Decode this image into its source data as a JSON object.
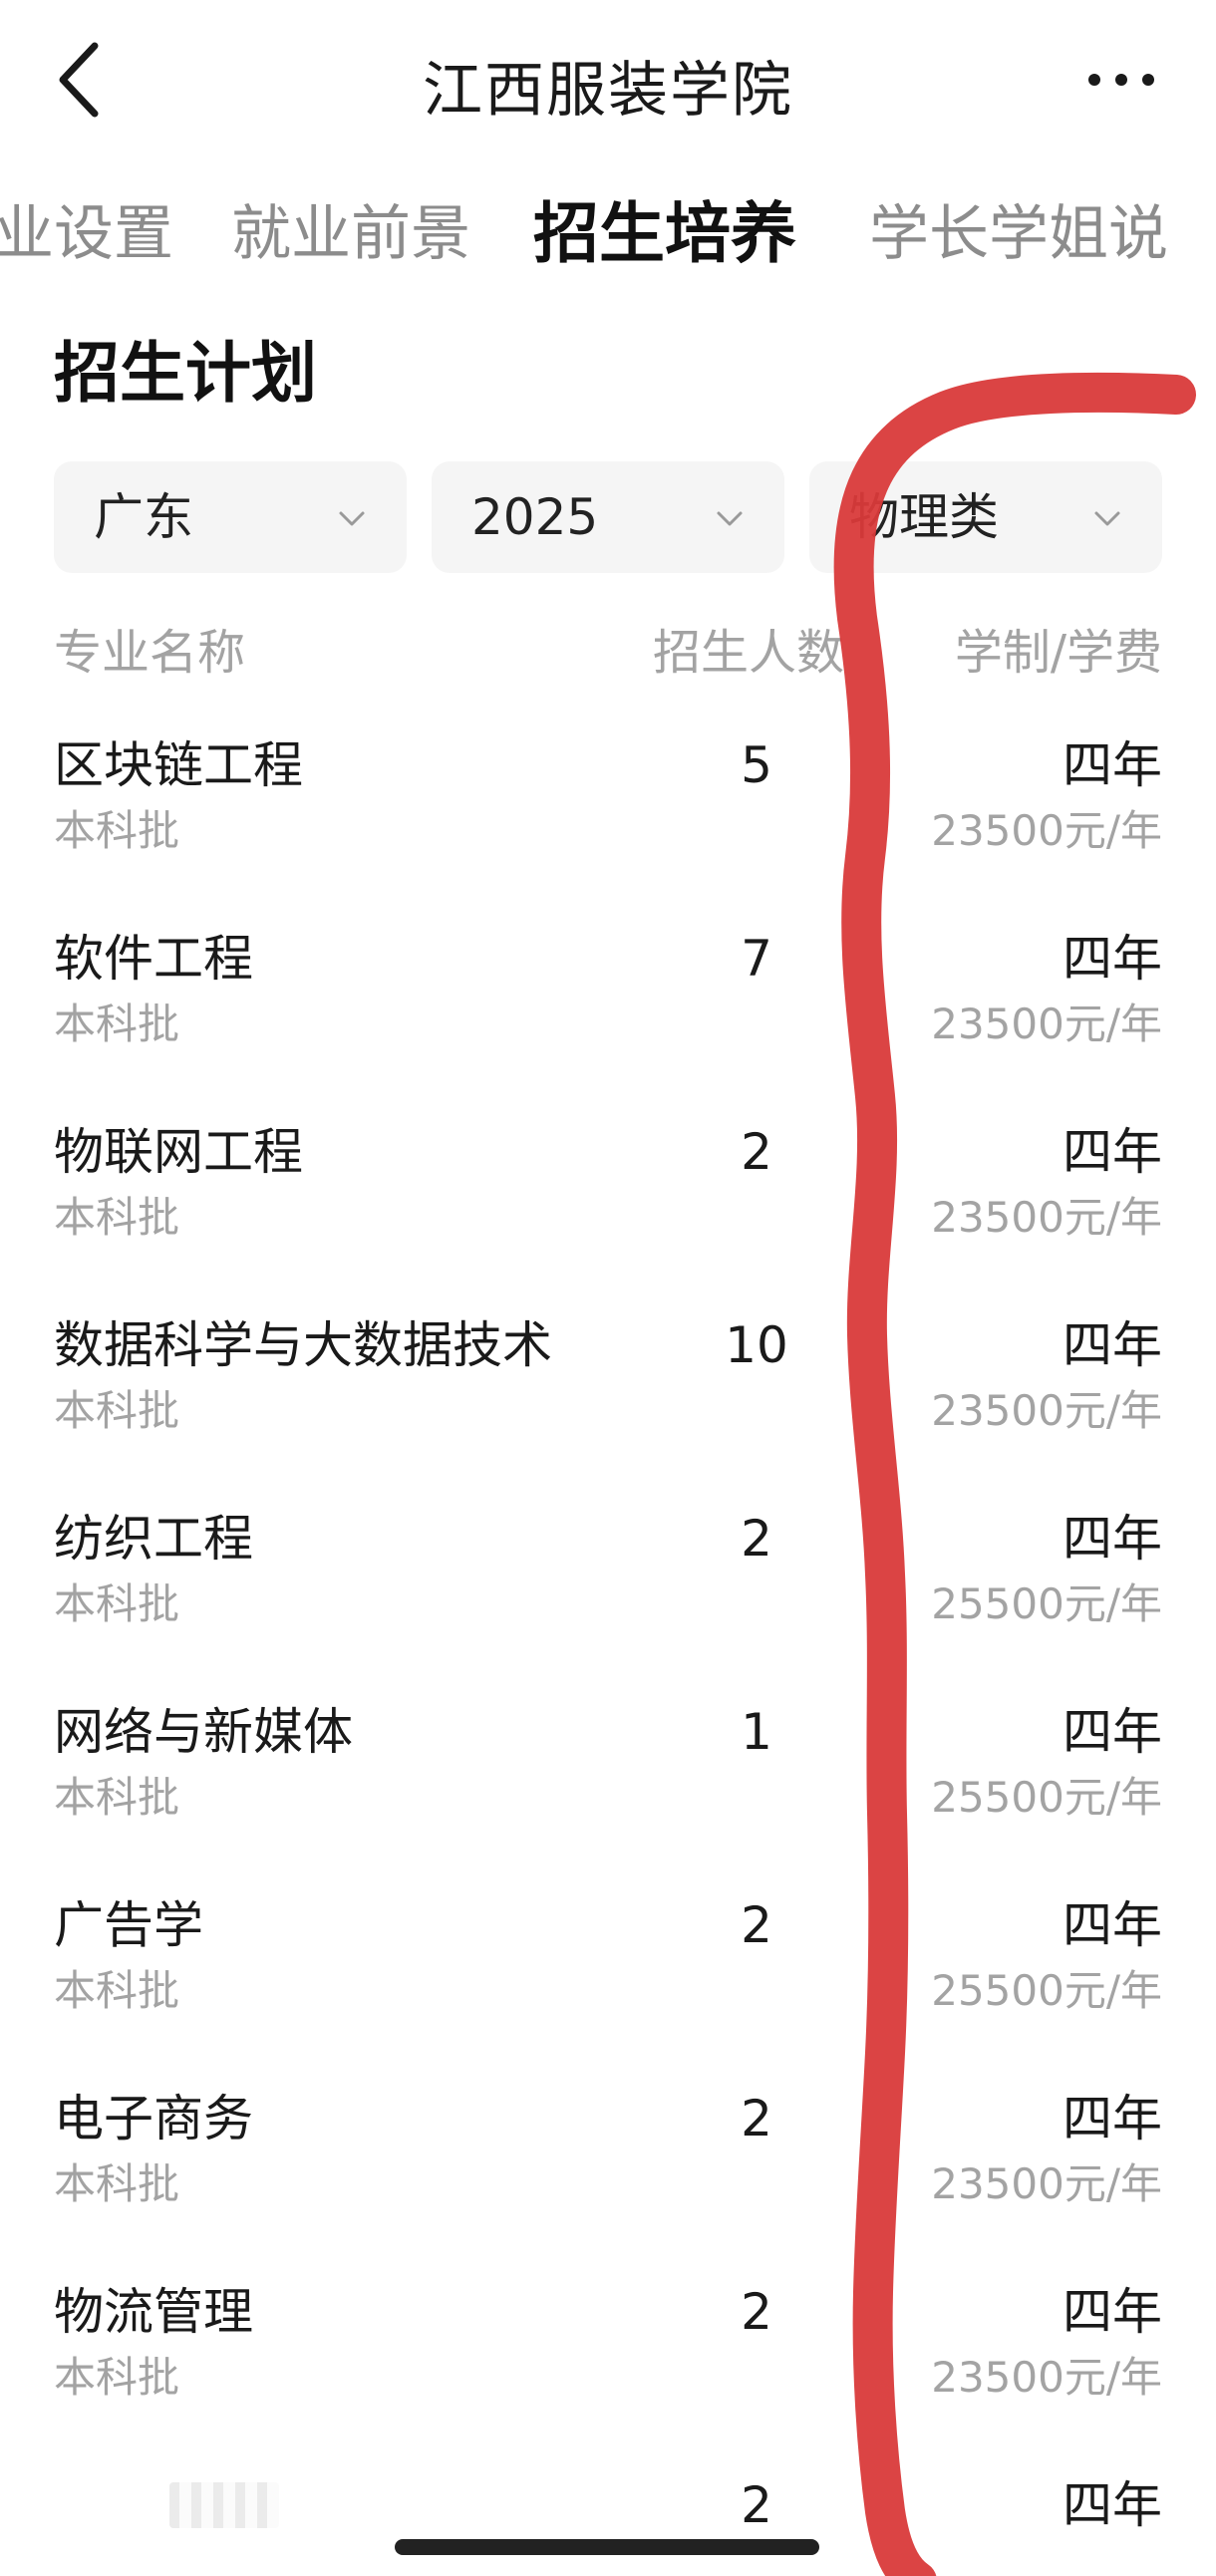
{
  "header": {
    "title": "江西服装学院",
    "back_icon": "chevron-left-icon",
    "more_icon": "more-horizontal-icon"
  },
  "tabs": [
    {
      "label": "业设置",
      "active": false
    },
    {
      "label": "就业前景",
      "active": false
    },
    {
      "label": "招生培养",
      "active": true
    },
    {
      "label": "学长学姐说",
      "active": false
    }
  ],
  "section": {
    "title": "招生计划"
  },
  "filters": {
    "province": "广东",
    "year": "2025",
    "subject": "物理类"
  },
  "columns": {
    "major": "专业名称",
    "count": "招生人数",
    "duration_fee": "学制/学费"
  },
  "rows": [
    {
      "major": "区块链工程",
      "batch": "本科批",
      "count": "5",
      "duration": "四年",
      "fee": "23500元/年"
    },
    {
      "major": "软件工程",
      "batch": "本科批",
      "count": "7",
      "duration": "四年",
      "fee": "23500元/年"
    },
    {
      "major": "物联网工程",
      "batch": "本科批",
      "count": "2",
      "duration": "四年",
      "fee": "23500元/年"
    },
    {
      "major": "数据科学与大数据技术",
      "batch": "本科批",
      "count": "10",
      "duration": "四年",
      "fee": "23500元/年"
    },
    {
      "major": "纺织工程",
      "batch": "本科批",
      "count": "2",
      "duration": "四年",
      "fee": "25500元/年"
    },
    {
      "major": "网络与新媒体",
      "batch": "本科批",
      "count": "1",
      "duration": "四年",
      "fee": "25500元/年"
    },
    {
      "major": "广告学",
      "batch": "本科批",
      "count": "2",
      "duration": "四年",
      "fee": "25500元/年"
    },
    {
      "major": "电子商务",
      "batch": "本科批",
      "count": "2",
      "duration": "四年",
      "fee": "23500元/年"
    },
    {
      "major": "物流管理",
      "batch": "本科批",
      "count": "2",
      "duration": "四年",
      "fee": "23500元/年"
    },
    {
      "major": "",
      "batch": "",
      "count": "2",
      "duration": "四年",
      "fee": ""
    }
  ],
  "colors": {
    "accent_text": "#111111",
    "muted_text": "#a3a3a3",
    "filter_bg": "#f5f5f5",
    "annotation_red": "#d93a3a"
  }
}
